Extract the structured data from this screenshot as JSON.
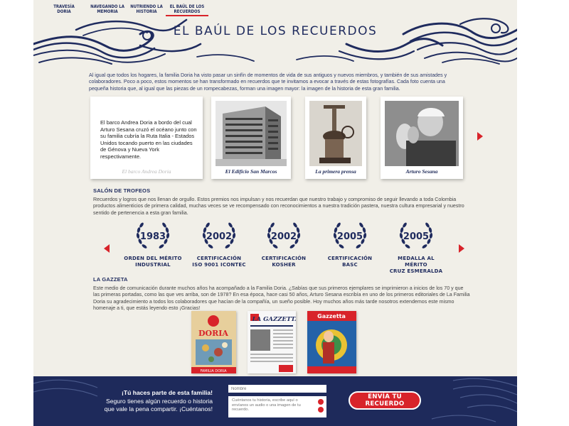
{
  "nav": [
    {
      "label": "TRAVESÍA DORIA"
    },
    {
      "label": "NAVEGANDO LA MEMORIA"
    },
    {
      "label": "NUTRIENDO LA HISTORIA"
    },
    {
      "label": "EL BAÚL DE LOS RECUERDOS",
      "active": true
    }
  ],
  "hero": {
    "title": "EL BAÚL DE LOS RECUERDOS"
  },
  "intro": "Al igual que todos los hogares, la familia Doria ha visto pasar un sinfín de momentos de vida de sus antiguos y nuevos miembros, y también de sus amistades y colaboradores. Poco a poco, estos momentos se han transformado en recuerdos que te invitamos a evocar a través de estas fotografías. Cada foto cuenta una pequeña historia que, al igual que las piezas de un rompecabezas, forman una imagen mayor: la imagen de la historia de esta gran familia.",
  "photos": [
    {
      "caption": "El barco Andrea Doria",
      "overlay": "El barco Andrea Doria a bordo del cual Arturo Sesana cruzó el océano junto con su familia cubría la Ruta Italia - Estados Unidos tocando puerto en las ciudades de Génova y Nueva York respectivamente."
    },
    {
      "caption": "El Edificio San Marcos"
    },
    {
      "caption": "La primera prensa"
    },
    {
      "caption": "Arturo Sesana"
    }
  ],
  "trophies": {
    "title": "SALÓN DE TROFEOS",
    "text": "Recuerdos y logros que nos llenan de orgullo. Estos premios nos impulsan y nos recuerdan que nuestro trabajo y compromiso de seguir llevando a toda Colombia productos alimenticios de primera calidad, muchas veces se ve recompensado con reconocimientos a nuestra tradición pastera, nuestra cultura empresarial y nuestro sentido de pertenencia a esta gran familia.",
    "items": [
      {
        "year": "1983",
        "name1": "ORDEN DEL MÉRITO",
        "name2": "INDUSTRIAL"
      },
      {
        "year": "2002",
        "name1": "CERTIFICACIÓN",
        "name2": "ISO 9001 ICONTEC"
      },
      {
        "year": "2002",
        "name1": "CERTIFICACIÓN",
        "name2": "KOSHER"
      },
      {
        "year": "2005",
        "name1": "CERTIFICACIÓN",
        "name2": "BASC"
      },
      {
        "year": "2005",
        "name1": "MEDALLA AL MÉRITO",
        "name2": "CRUZ ESMERALDA"
      }
    ]
  },
  "gazzetta": {
    "title": "LA GAZZETA",
    "text": "Este medio de comunicación durante muchos años ha acompañado a la Familia Doria. ¿Sabías que sus primeros ejemplares se imprimieron a inicios de los 70 y que las primeras portadas, como las que ves arriba, son de 1978? En esa época, hace casi 50 años, Arturo Sesana escribía en uno de los primeros editoriales de La Familia Doria su agradecimiento a todos los colaboradores que hacían de la compañía, un sueño posible. Hoy muchos años más tarde nosotros extendemos este mismo homenaje a ti, que estás leyendo esto ¡Gracias!",
    "covers": [
      {
        "masthead": "DORIA",
        "footer": "FAMILIA DORIA"
      },
      {
        "masthead": "LA GAZZETTA"
      },
      {
        "masthead": "Gazzetta"
      }
    ]
  },
  "footer": {
    "line1": "¡Tú haces parte de esta familia!",
    "line2": "Seguro tienes algún recuerdo o historia",
    "line3": "que vale la pena compartir. ¡Cuéntanos!",
    "name_placeholder": "Nombre",
    "story_placeholder": "Cuéntanos tu historia, escribe aquí o envíanos un audio o una imagen de tu recuerdo.",
    "send_label": "ENVÍA TU RECUERDO"
  },
  "colors": {
    "navy": "#1f2b5e",
    "red": "#d8232a",
    "cream": "#f1efe8"
  }
}
